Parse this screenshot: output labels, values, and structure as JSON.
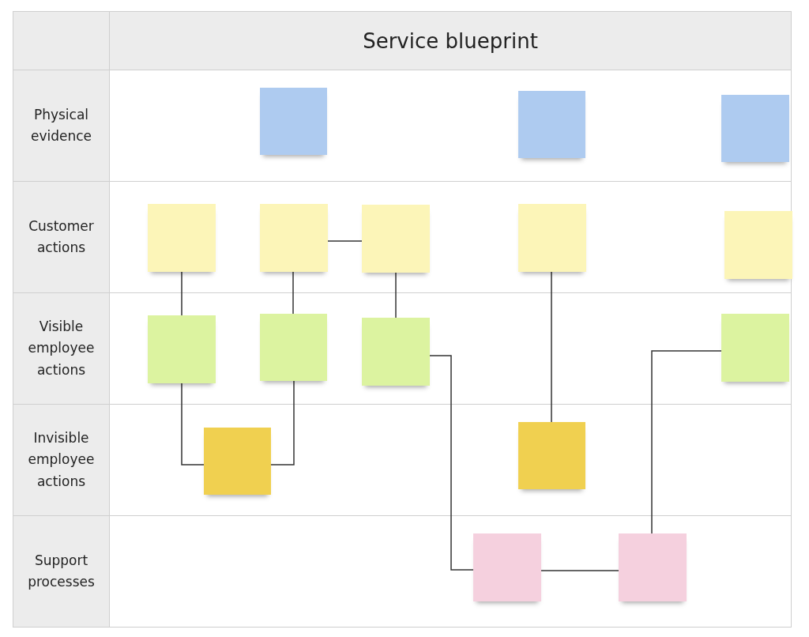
{
  "title": "Service blueprint",
  "lanes": [
    {
      "label": "Physical evidence",
      "notes": [
        {
          "color": "#aecbf0"
        },
        {
          "color": "#aecbf0"
        },
        {
          "color": "#aecbf0"
        }
      ]
    },
    {
      "label": "Customer actions",
      "notes": [
        {
          "color": "#fcf5b8"
        },
        {
          "color": "#fcf5b8"
        },
        {
          "color": "#fcf5b8"
        },
        {
          "color": "#fcf5b8"
        },
        {
          "color": "#fcf5b8"
        }
      ]
    },
    {
      "label": "Visible employee actions",
      "notes": [
        {
          "color": "#dcf3a0"
        },
        {
          "color": "#dcf3a0"
        },
        {
          "color": "#dcf3a0"
        },
        {
          "color": "#dcf3a0"
        }
      ]
    },
    {
      "label": "Invisible employee actions",
      "notes": [
        {
          "color": "#f0d050"
        },
        {
          "color": "#f0d050"
        }
      ]
    },
    {
      "label": "Support processes",
      "notes": [
        {
          "color": "#f5d0de"
        },
        {
          "color": "#f5d0de"
        }
      ]
    }
  ]
}
